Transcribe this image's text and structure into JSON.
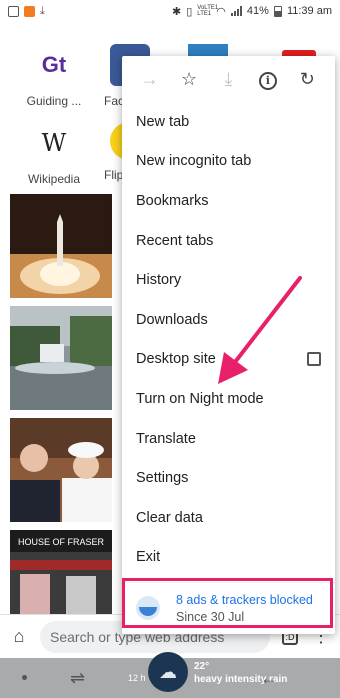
{
  "status_bar": {
    "signal_label": "VoLTE1 LTE1",
    "battery": "41%",
    "time": "11:39 am"
  },
  "shortcuts": [
    {
      "label": "Guiding ...",
      "icon": "Gt",
      "color": "#5b2ca0"
    },
    {
      "label": "Fac",
      "icon": "f",
      "color": "#3b5998"
    },
    {
      "label": "",
      "icon": "",
      "color": "#2f7fc1"
    },
    {
      "label": "",
      "icon": "",
      "color": "#e02020"
    },
    {
      "label": "Wikipedia",
      "icon": "W",
      "color": "#ffffff"
    },
    {
      "label": "Flip",
      "icon": "",
      "color": "#f7d21b"
    }
  ],
  "menu": {
    "toolbar": [
      "forward-icon",
      "star-icon",
      "download-icon",
      "info-icon",
      "refresh-icon"
    ],
    "items": [
      {
        "label": "New tab"
      },
      {
        "label": "New incognito tab"
      },
      {
        "label": "Bookmarks"
      },
      {
        "label": "Recent tabs"
      },
      {
        "label": "History"
      },
      {
        "label": "Downloads"
      },
      {
        "label": "Desktop site",
        "checkbox": false
      },
      {
        "label": "Turn on Night mode"
      },
      {
        "label": "Translate"
      },
      {
        "label": "Settings"
      },
      {
        "label": "Clear data"
      },
      {
        "label": "Exit"
      }
    ],
    "blocked": {
      "title": "8 ads & trackers blocked",
      "subtitle": "Since 30 Jul"
    }
  },
  "address_bar": {
    "placeholder": "Search or type web address",
    "tab_count": ":D"
  },
  "nav_bar": {
    "hour": "12 h",
    "temperature": "22°",
    "condition": "heavy intensity rain"
  },
  "colors": {
    "highlight": "#e8206a",
    "link": "#1a73e8",
    "navbar": "#a9aaac"
  }
}
